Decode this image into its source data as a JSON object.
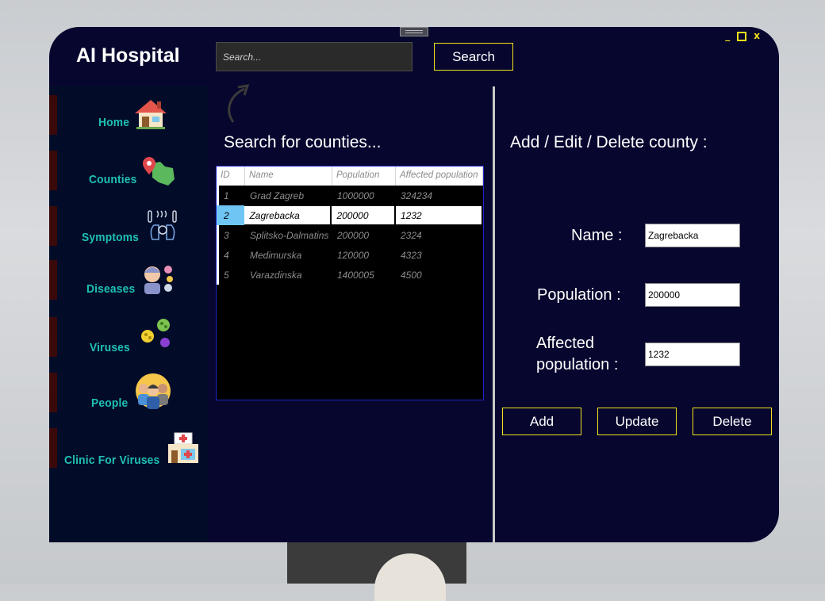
{
  "app": {
    "title": "AI Hospital"
  },
  "window_controls": {
    "minimize": "_",
    "close": "x"
  },
  "search": {
    "placeholder": "Search...",
    "value": "",
    "button_label": "Search"
  },
  "sidebar": {
    "items": [
      {
        "label": "Home",
        "icon": "house-icon"
      },
      {
        "label": "Counties",
        "icon": "map-pin-icon"
      },
      {
        "label": "Symptoms",
        "icon": "symptoms-icon"
      },
      {
        "label": "Diseases",
        "icon": "sick-person-icon"
      },
      {
        "label": "Viruses",
        "icon": "virus-icon"
      },
      {
        "label": "People",
        "icon": "people-group-icon"
      },
      {
        "label": "Clinic For Viruses",
        "icon": "clinic-icon"
      }
    ]
  },
  "left_panel": {
    "heading": "Search for counties...",
    "table": {
      "columns": [
        "ID",
        "Name",
        "Population",
        "Affected population"
      ],
      "rows": [
        {
          "id": "1",
          "name": "Grad Zagreb",
          "population": "1000000",
          "affected": "324234"
        },
        {
          "id": "2",
          "name": "Zagrebacka",
          "population": "200000",
          "affected": "1232"
        },
        {
          "id": "3",
          "name": "Splitsko-Dalmatins",
          "population": "200000",
          "affected": "2324"
        },
        {
          "id": "4",
          "name": "Medimurska",
          "population": "120000",
          "affected": "4323"
        },
        {
          "id": "5",
          "name": "Varazdinska",
          "population": "1400005",
          "affected": "4500"
        }
      ],
      "selected_row": 2
    }
  },
  "right_panel": {
    "heading": "Add / Edit / Delete county :",
    "fields": {
      "name_label": "Name :",
      "name_value": "Zagrebacka",
      "population_label": "Population :",
      "population_value": "200000",
      "affected_label_line1": "Affected",
      "affected_label_line2": "population :",
      "affected_value": "1232"
    },
    "buttons": {
      "add": "Add",
      "update": "Update",
      "delete": "Delete"
    }
  },
  "colors": {
    "window_bg": "#07062e",
    "sidebar_bg": "#020c28",
    "accent_border": "#f1e21e",
    "nav_text": "#1fc0b4",
    "selection": "#6fc6f5"
  }
}
